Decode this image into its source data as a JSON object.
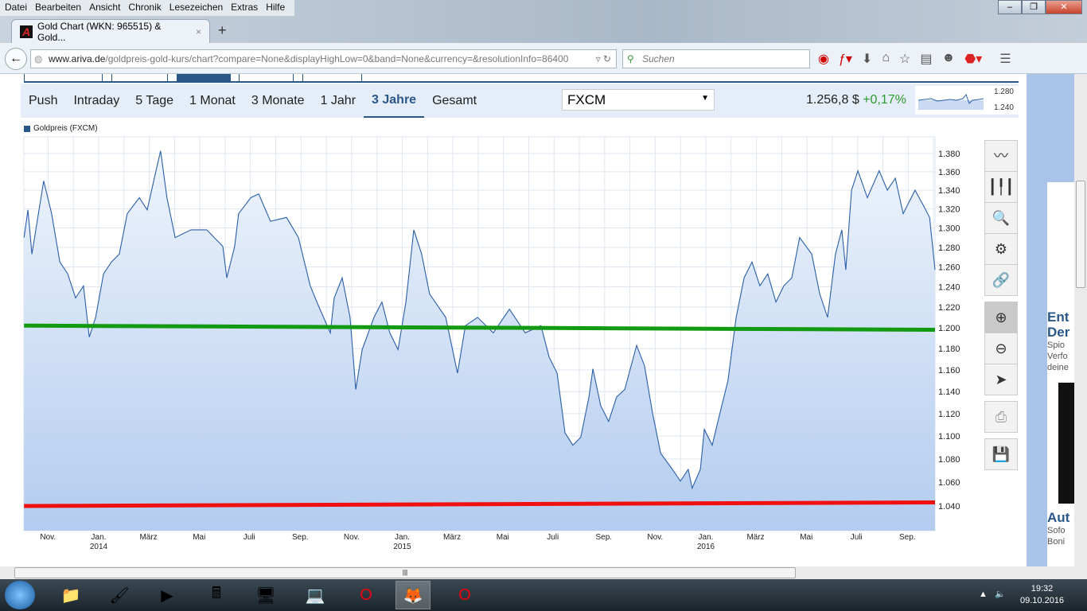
{
  "browser": {
    "menu": [
      "Datei",
      "Bearbeiten",
      "Ansicht",
      "Chronik",
      "Lesezeichen",
      "Extras",
      "Hilfe"
    ],
    "tab_title": "Gold Chart (WKN: 965515) & Gold...",
    "tab_close": "×",
    "new_tab": "+",
    "url_host": "www.ariva.de",
    "url_path": "/goldpreis-gold-kurs/chart?compare=None&displayHighLow=0&band=None&currency=&resolutionInfo=86400",
    "search_placeholder": "Suchen",
    "window_buttons": [
      "–",
      "❐",
      "✕"
    ]
  },
  "page": {
    "periods": [
      "Push",
      "Intraday",
      "5 Tage",
      "1 Monat",
      "3 Monate",
      "1 Jahr",
      "3 Jahre",
      "Gesamt"
    ],
    "active_period": "3 Jahre",
    "exchange": "FXCM",
    "price": "1.256,8 $",
    "change": "+0,17%",
    "mini_labels": [
      "1.280",
      "1.240"
    ],
    "legend": "Goldpreis (FXCM)",
    "ad": {
      "h1": "Ent",
      "h2": "Der",
      "s": [
        "Spio",
        "Verfo",
        "deine"
      ],
      "h3": "Aut",
      "s2": [
        "Sofo",
        "Boni"
      ]
    }
  },
  "toolbox": [
    "line-chart-icon",
    "candlestick-icon",
    "indicator-search-icon",
    "settings-icon",
    "link-icon",
    "zoom-in-icon",
    "zoom-out-icon",
    "pointer-icon",
    "print-icon",
    "save-icon"
  ],
  "chart_data": {
    "type": "line",
    "title": "Goldpreis (FXCM)",
    "y_scale": "log",
    "ylim": [
      1030,
      1395
    ],
    "y_ticks": [
      1380,
      1360,
      1340,
      1320,
      1300,
      1280,
      1260,
      1240,
      1220,
      1200,
      1180,
      1160,
      1140,
      1120,
      1100,
      1080,
      1060,
      1040
    ],
    "y_tick_labels": [
      "1.380",
      "1.360",
      "1.340",
      "1.320",
      "1.300",
      "1.280",
      "1.260",
      "1.240",
      "1.220",
      "1.200",
      "1.180",
      "1.160",
      "1.140",
      "1.120",
      "1.100",
      "1.080",
      "1.060",
      "1.040"
    ],
    "xlim": [
      2013.754,
      2016.755
    ],
    "x_ticks": [
      {
        "t": 2013.833,
        "label": "Nov."
      },
      {
        "t": 2014.0,
        "label": "Jan.",
        "year": "2014"
      },
      {
        "t": 2014.164,
        "label": "März"
      },
      {
        "t": 2014.331,
        "label": "Mai"
      },
      {
        "t": 2014.496,
        "label": "Juli"
      },
      {
        "t": 2014.664,
        "label": "Sep."
      },
      {
        "t": 2014.833,
        "label": "Nov."
      },
      {
        "t": 2015.0,
        "label": "Jan.",
        "year": "2015"
      },
      {
        "t": 2015.164,
        "label": "März"
      },
      {
        "t": 2015.331,
        "label": "Mai"
      },
      {
        "t": 2015.496,
        "label": "Juli"
      },
      {
        "t": 2015.664,
        "label": "Sep."
      },
      {
        "t": 2015.833,
        "label": "Nov."
      },
      {
        "t": 2016.0,
        "label": "Jan.",
        "year": "2016"
      },
      {
        "t": 2016.164,
        "label": "März"
      },
      {
        "t": 2016.331,
        "label": "Mai"
      },
      {
        "t": 2016.496,
        "label": "Juli"
      },
      {
        "t": 2016.664,
        "label": "Sep."
      }
    ],
    "series": [
      {
        "name": "Goldpreis (FXCM)",
        "color": "#2a5ea8",
        "points": [
          [
            2013.754,
            1290
          ],
          [
            2013.767,
            1319
          ],
          [
            2013.78,
            1273
          ],
          [
            2013.819,
            1350
          ],
          [
            2013.845,
            1315
          ],
          [
            2013.872,
            1265
          ],
          [
            2013.898,
            1253
          ],
          [
            2013.924,
            1229
          ],
          [
            2013.95,
            1241
          ],
          [
            2013.969,
            1191
          ],
          [
            2013.99,
            1210
          ],
          [
            2014.016,
            1253
          ],
          [
            2014.042,
            1265
          ],
          [
            2014.068,
            1273
          ],
          [
            2014.094,
            1315
          ],
          [
            2014.134,
            1332
          ],
          [
            2014.16,
            1319
          ],
          [
            2014.186,
            1357
          ],
          [
            2014.204,
            1383
          ],
          [
            2014.225,
            1332
          ],
          [
            2014.252,
            1290
          ],
          [
            2014.304,
            1298
          ],
          [
            2014.356,
            1298
          ],
          [
            2014.409,
            1281
          ],
          [
            2014.422,
            1249
          ],
          [
            2014.448,
            1281
          ],
          [
            2014.461,
            1315
          ],
          [
            2014.501,
            1332
          ],
          [
            2014.527,
            1336
          ],
          [
            2014.566,
            1307
          ],
          [
            2014.619,
            1311
          ],
          [
            2014.658,
            1290
          ],
          [
            2014.697,
            1241
          ],
          [
            2014.723,
            1222
          ],
          [
            2014.763,
            1195
          ],
          [
            2014.776,
            1229
          ],
          [
            2014.802,
            1249
          ],
          [
            2014.828,
            1210
          ],
          [
            2014.847,
            1142
          ],
          [
            2014.868,
            1179
          ],
          [
            2014.907,
            1210
          ],
          [
            2014.933,
            1225
          ],
          [
            2014.959,
            1195
          ],
          [
            2014.986,
            1179
          ],
          [
            2015.012,
            1225
          ],
          [
            2015.038,
            1298
          ],
          [
            2015.064,
            1273
          ],
          [
            2015.09,
            1233
          ],
          [
            2015.143,
            1210
          ],
          [
            2015.182,
            1157
          ],
          [
            2015.208,
            1202
          ],
          [
            2015.248,
            1210
          ],
          [
            2015.3,
            1195
          ],
          [
            2015.353,
            1218
          ],
          [
            2015.405,
            1195
          ],
          [
            2015.457,
            1202
          ],
          [
            2015.484,
            1172
          ],
          [
            2015.51,
            1157
          ],
          [
            2015.536,
            1103
          ],
          [
            2015.562,
            1092
          ],
          [
            2015.588,
            1099
          ],
          [
            2015.615,
            1135
          ],
          [
            2015.628,
            1161
          ],
          [
            2015.654,
            1127
          ],
          [
            2015.68,
            1113
          ],
          [
            2015.706,
            1135
          ],
          [
            2015.733,
            1142
          ],
          [
            2015.772,
            1183
          ],
          [
            2015.798,
            1164
          ],
          [
            2015.824,
            1121
          ],
          [
            2015.851,
            1085
          ],
          [
            2015.89,
            1071
          ],
          [
            2015.916,
            1061
          ],
          [
            2015.942,
            1071
          ],
          [
            2015.955,
            1055
          ],
          [
            2015.982,
            1071
          ],
          [
            2015.995,
            1106
          ],
          [
            2016.021,
            1092
          ],
          [
            2016.047,
            1121
          ],
          [
            2016.073,
            1150
          ],
          [
            2016.1,
            1210
          ],
          [
            2016.126,
            1249
          ],
          [
            2016.152,
            1265
          ],
          [
            2016.178,
            1241
          ],
          [
            2016.204,
            1253
          ],
          [
            2016.231,
            1225
          ],
          [
            2016.257,
            1241
          ],
          [
            2016.283,
            1249
          ],
          [
            2016.309,
            1290
          ],
          [
            2016.349,
            1273
          ],
          [
            2016.375,
            1233
          ],
          [
            2016.401,
            1210
          ],
          [
            2016.427,
            1273
          ],
          [
            2016.448,
            1298
          ],
          [
            2016.461,
            1257
          ],
          [
            2016.48,
            1340
          ],
          [
            2016.501,
            1361
          ],
          [
            2016.532,
            1332
          ],
          [
            2016.571,
            1361
          ],
          [
            2016.598,
            1340
          ],
          [
            2016.624,
            1353
          ],
          [
            2016.65,
            1315
          ],
          [
            2016.689,
            1340
          ],
          [
            2016.716,
            1324
          ],
          [
            2016.737,
            1311
          ],
          [
            2016.755,
            1257
          ]
        ]
      }
    ],
    "trendlines": [
      {
        "name": "support-line-green",
        "color": "#139a13",
        "from": [
          2013.754,
          1202
        ],
        "to": [
          2016.755,
          1198
        ]
      },
      {
        "name": "support-line-red",
        "color": "#f01010",
        "from": [
          2013.754,
          1040
        ],
        "to": [
          2016.755,
          1043
        ]
      }
    ],
    "grid": true,
    "legend_position": "top-left"
  },
  "taskbar": {
    "apps": [
      "explorer",
      "paint",
      "media-player",
      "calculator",
      "remote-desktop",
      "network",
      "opera",
      "firefox",
      "opera-2"
    ],
    "time": "19:32",
    "date": "09.10.2016"
  }
}
